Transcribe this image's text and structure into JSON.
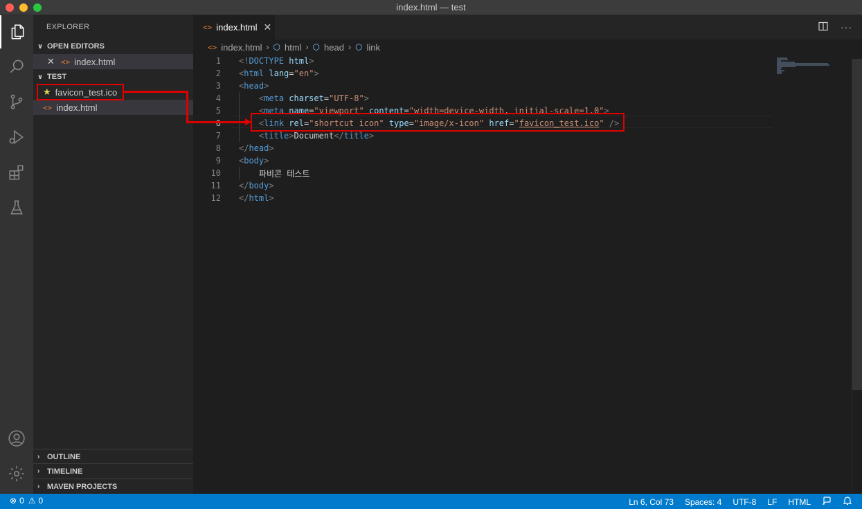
{
  "window": {
    "title": "index.html — test"
  },
  "activity_bar": {
    "items": [
      "explorer-icon",
      "search-icon",
      "source-control-icon",
      "run-debug-icon",
      "extensions-icon",
      "testing-icon"
    ],
    "bottom": [
      "account-icon",
      "settings-gear-icon"
    ]
  },
  "sidebar": {
    "title": "EXPLORER",
    "open_editors": {
      "label": "OPEN EDITORS",
      "items": [
        {
          "name": "index.html"
        }
      ]
    },
    "folder": {
      "label": "TEST",
      "items": [
        {
          "name": "favicon_test.ico",
          "icon": "star-icon"
        },
        {
          "name": "index.html",
          "icon": "html-icon"
        }
      ]
    },
    "outline": "OUTLINE",
    "timeline": "TIMELINE",
    "maven": "MAVEN PROJECTS"
  },
  "tabs": [
    {
      "label": "index.html",
      "active": true
    }
  ],
  "breadcrumb": [
    "index.html",
    "html",
    "head",
    "link"
  ],
  "editor": {
    "current_line": 6,
    "lines": [
      {
        "n": "1",
        "tokens": [
          [
            "t",
            "<!"
          ],
          [
            "tag",
            "DOCTYPE"
          ],
          [
            "txt",
            " "
          ],
          [
            "attr",
            "html"
          ],
          [
            "t",
            ">"
          ]
        ]
      },
      {
        "n": "2",
        "tokens": [
          [
            "t",
            "<"
          ],
          [
            "tag",
            "html"
          ],
          [
            "txt",
            " "
          ],
          [
            "attr",
            "lang"
          ],
          [
            "txt",
            "="
          ],
          [
            "str",
            "\"en\""
          ],
          [
            "t",
            ">"
          ]
        ]
      },
      {
        "n": "3",
        "tokens": [
          [
            "t",
            "<"
          ],
          [
            "tag",
            "head"
          ],
          [
            "t",
            ">"
          ]
        ]
      },
      {
        "n": "4",
        "tokens": [
          [
            "txt",
            "    "
          ],
          [
            "t",
            "<"
          ],
          [
            "tag",
            "meta"
          ],
          [
            "txt",
            " "
          ],
          [
            "attr",
            "charset"
          ],
          [
            "txt",
            "="
          ],
          [
            "str",
            "\"UTF-8\""
          ],
          [
            "t",
            ">"
          ]
        ]
      },
      {
        "n": "5",
        "tokens": [
          [
            "txt",
            "    "
          ],
          [
            "t",
            "<"
          ],
          [
            "tag",
            "meta"
          ],
          [
            "txt",
            " "
          ],
          [
            "attr",
            "name"
          ],
          [
            "txt",
            "="
          ],
          [
            "str",
            "\"viewport\""
          ],
          [
            "txt",
            " "
          ],
          [
            "attr",
            "content"
          ],
          [
            "txt",
            "="
          ],
          [
            "str",
            "\"width=device-width, initial-scale=1.0\""
          ],
          [
            "t",
            ">"
          ]
        ]
      },
      {
        "n": "6",
        "tokens": [
          [
            "txt",
            "    "
          ],
          [
            "t",
            "<"
          ],
          [
            "tag",
            "link"
          ],
          [
            "txt",
            " "
          ],
          [
            "attr",
            "rel"
          ],
          [
            "txt",
            "="
          ],
          [
            "str",
            "\"shortcut icon\""
          ],
          [
            "txt",
            " "
          ],
          [
            "attr",
            "type"
          ],
          [
            "txt",
            "="
          ],
          [
            "str",
            "\"image/x-icon\""
          ],
          [
            "txt",
            " "
          ],
          [
            "attr",
            "href"
          ],
          [
            "txt",
            "="
          ],
          [
            "str",
            "\""
          ],
          [
            "strU",
            "favicon_test.ico"
          ],
          [
            "str",
            "\""
          ],
          [
            "txt",
            " "
          ],
          [
            "t",
            "/>"
          ]
        ]
      },
      {
        "n": "7",
        "tokens": [
          [
            "txt",
            "    "
          ],
          [
            "t",
            "<"
          ],
          [
            "tag",
            "title"
          ],
          [
            "t",
            ">"
          ],
          [
            "txt",
            "Document"
          ],
          [
            "t",
            "</"
          ],
          [
            "tag",
            "title"
          ],
          [
            "t",
            ">"
          ]
        ]
      },
      {
        "n": "8",
        "tokens": [
          [
            "t",
            "</"
          ],
          [
            "tag",
            "head"
          ],
          [
            "t",
            ">"
          ]
        ]
      },
      {
        "n": "9",
        "tokens": [
          [
            "t",
            "<"
          ],
          [
            "tag",
            "body"
          ],
          [
            "t",
            ">"
          ]
        ]
      },
      {
        "n": "10",
        "tokens": [
          [
            "txt",
            "    파비콘 테스트"
          ]
        ]
      },
      {
        "n": "11",
        "tokens": [
          [
            "t",
            "</"
          ],
          [
            "tag",
            "body"
          ],
          [
            "t",
            ">"
          ]
        ]
      },
      {
        "n": "12",
        "tokens": [
          [
            "t",
            "</"
          ],
          [
            "tag",
            "html"
          ],
          [
            "t",
            ">"
          ]
        ]
      }
    ]
  },
  "status_bar": {
    "errors": "0",
    "warnings": "0",
    "position": "Ln 6, Col 73",
    "spaces": "Spaces: 4",
    "encoding": "UTF-8",
    "eol": "LF",
    "language": "HTML"
  },
  "colors": {
    "accent": "#007acc",
    "annotation": "#e00000"
  }
}
